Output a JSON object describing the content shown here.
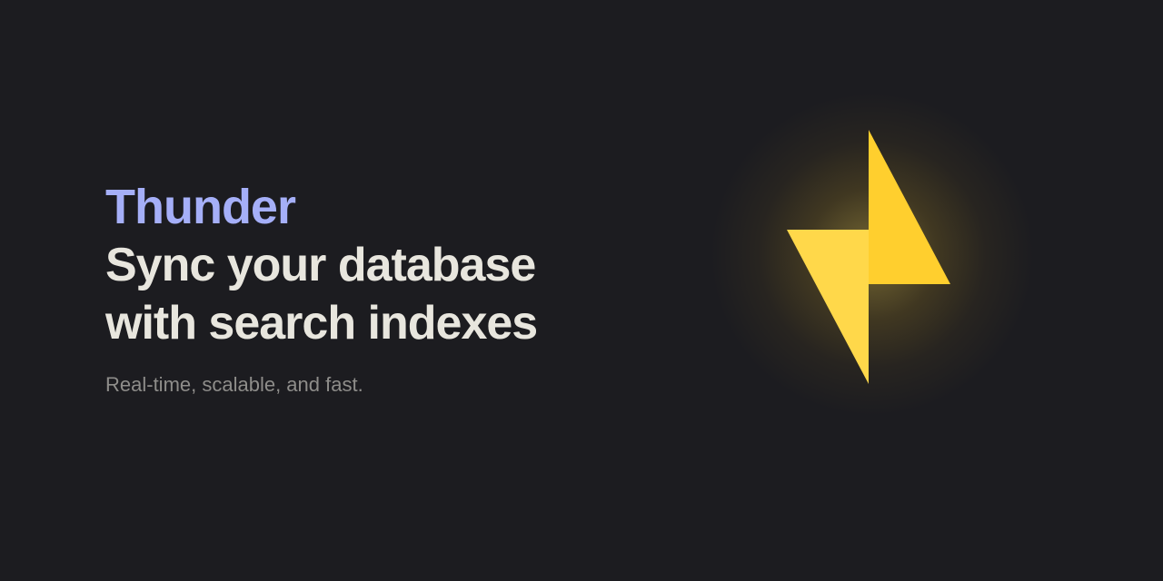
{
  "hero": {
    "brand": "Thunder",
    "headline_line1": "Sync your database",
    "headline_line2": "with search indexes",
    "tagline": "Real-time, scalable, and fast."
  },
  "logo": {
    "icon": "lightning-bolt-icon",
    "colors": {
      "left_half": "#ffd84a",
      "right_half": "#ffcf2e",
      "glow": "#ffd84a"
    }
  },
  "colors": {
    "background": "#1c1c20",
    "brand": "#a5aff8",
    "headline": "#e8e6de",
    "tagline": "#8e8d8a"
  }
}
